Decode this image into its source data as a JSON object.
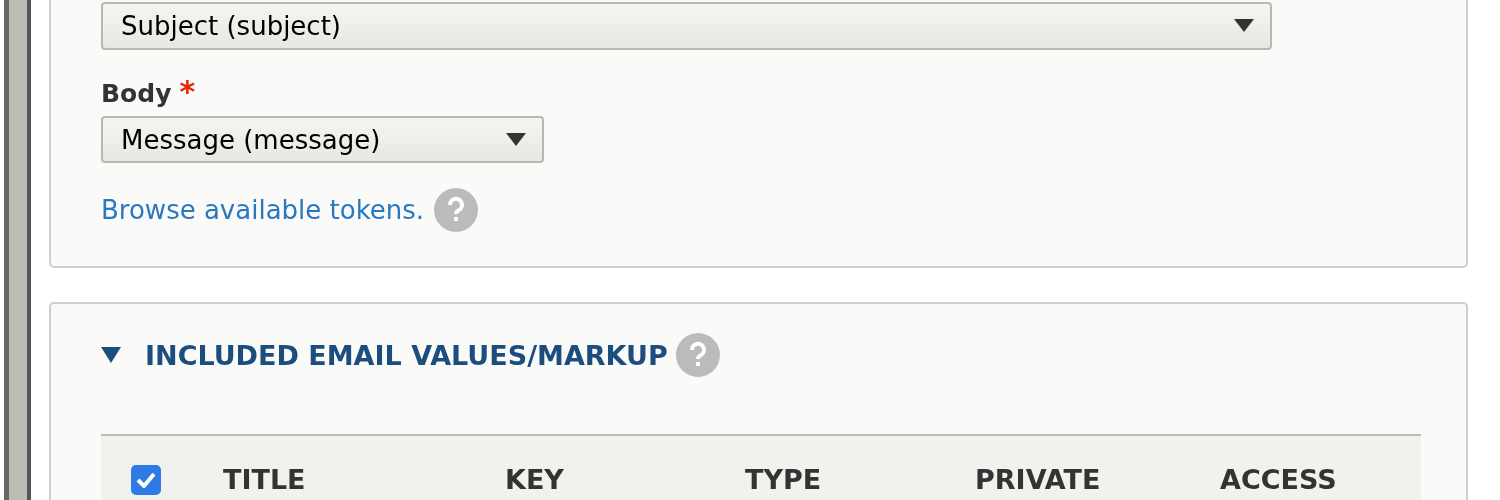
{
  "settings_card": {
    "fields": [
      {
        "kind": "select",
        "value": "Subject (subject)"
      },
      {
        "kind": "select",
        "label": "Body",
        "required_mark": "*",
        "value": "Message (message)"
      }
    ],
    "token_link": "Browse available tokens."
  },
  "section": {
    "title": "INCLUDED EMAIL VALUES/MARKUP",
    "expanded": true,
    "table": {
      "select_all": {
        "checked": true
      },
      "columns": [
        "TITLE",
        "KEY",
        "TYPE",
        "PRIVATE",
        "ACCESS"
      ]
    }
  }
}
